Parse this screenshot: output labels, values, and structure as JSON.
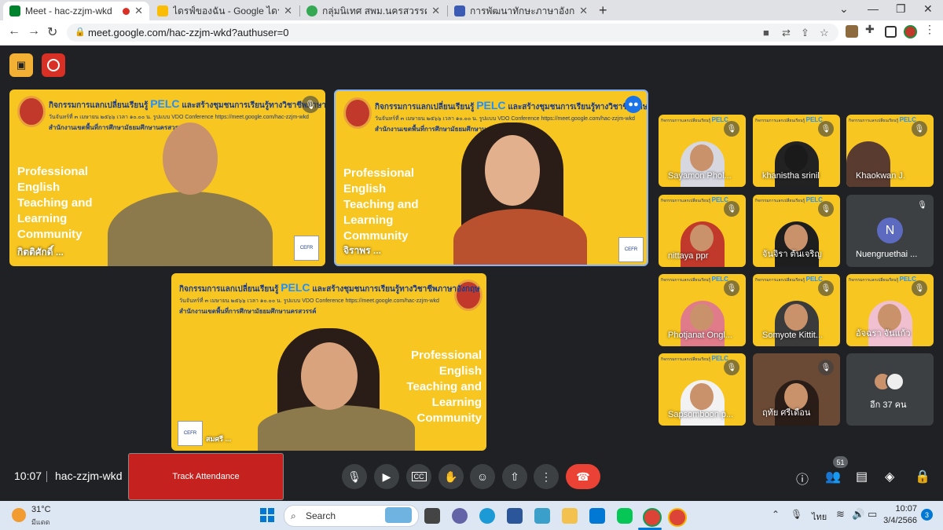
{
  "browser": {
    "tabs": [
      {
        "title": "Meet - hac-zzjm-wkd",
        "favicon_color": "#00832d"
      },
      {
        "title": "ไดรฟ์ของฉัน - Google ไดรฟ์",
        "favicon_color": "#fbbc04"
      },
      {
        "title": "กลุ่มนิเทศ สพม.นครสวรรค์",
        "favicon_color": "#34a853"
      },
      {
        "title": "การพัฒนาทักษะภาษาอังกฤษ English",
        "favicon_color": "#3b5bb5"
      }
    ],
    "address": "meet.google.com/hac-zzjm-wkd?authuser=0"
  },
  "slide": {
    "activity_prefix": "กิจกรรมการแลกเปลี่ยนเรียนรู้",
    "pelc": "PELC",
    "activity_suffix": "และสร้างชุมชนการเรียนรู้ทางวิชาชีพภาษาอังกฤษ",
    "date_line": "วันจันทร์ที่ ๓ เมษายน ๒๕๖๖ เวลา ๑๐.๐๐ น. รูปแบบ VDO Conference https://meet.google.com/hac-zzjm-wkd",
    "org_line": "สำนักงานเขตพื้นที่การศึกษามัธยมศึกษานครสวรรค์",
    "title": "Professional English Teaching and Learning Community",
    "cefr": "CEFR"
  },
  "participants": {
    "main": [
      {
        "name": "กิตติศักดิ์ ..."
      },
      {
        "name": "จิราพร ..."
      },
      {
        "name": "สมศรี ..."
      }
    ],
    "grid": [
      {
        "name": "Sayamon Phol..."
      },
      {
        "name": "khanistha srinil"
      },
      {
        "name": "Khaokwan J."
      },
      {
        "name": "nittaya ppr"
      },
      {
        "name": "จันจิรา ต้นเจริญ"
      },
      {
        "name": "Nuengruethai ...",
        "initial": "N"
      },
      {
        "name": "Photjanat Ongl..."
      },
      {
        "name": "Somyote Kittit..."
      },
      {
        "name": "อัจฉรา จันแก้ว"
      },
      {
        "name": "Sapsomboon p..."
      },
      {
        "name": "ฤทัย ศรีเดือน"
      }
    ],
    "more": "อีก 37 คน"
  },
  "meeting": {
    "time": "10:07",
    "code": "hac-zzjm-wkd",
    "track_attendance": "Track Attendance",
    "participant_count": "51"
  },
  "taskbar": {
    "weather_temp": "31°C",
    "weather_desc": "มีแดด",
    "search_label": "Search",
    "lang": "ไทย",
    "time": "10:07",
    "date": "3/4/2566",
    "notif_count": "3"
  },
  "colors": {
    "slide_yellow": "#f8c620",
    "hangup": "#ea4335",
    "track": "#c5221f",
    "meet_bg": "#202124"
  }
}
